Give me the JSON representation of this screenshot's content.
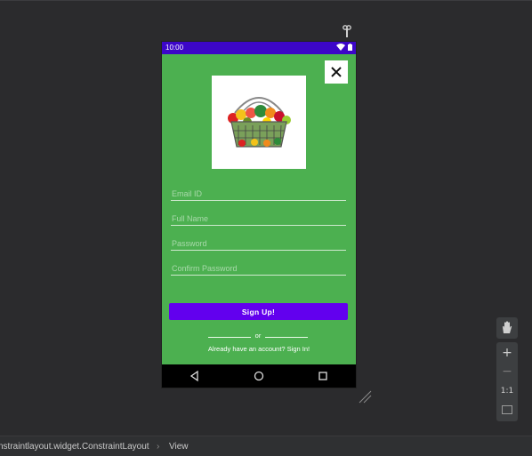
{
  "statusbar": {
    "time": "10:00"
  },
  "form": {
    "email_placeholder": "Email ID",
    "fullname_placeholder": "Full Name",
    "password_placeholder": "Password",
    "confirm_placeholder": "Confirm Password",
    "signup_label": "Sign Up!",
    "or_text": "or",
    "signin_text": "Already have an account? Sign In!"
  },
  "zoom_toolbar": {
    "zoom_in": "+",
    "zoom_out": "−",
    "actual_size": "1:1"
  },
  "breadcrumb": {
    "item1": "nstraintlayout.widget.ConstraintLayout",
    "separator": "›",
    "item2": "View"
  },
  "colors": {
    "screen_bg": "#4cb050",
    "statusbar": "#3c06c8",
    "button": "#6200ee"
  },
  "icons": [
    "pin-icon",
    "wifi-icon",
    "battery-icon",
    "close-icon",
    "basket-image",
    "back-icon",
    "home-icon",
    "recents-icon",
    "hand-icon",
    "fit-screen-icon",
    "resize-handle-icon"
  ]
}
